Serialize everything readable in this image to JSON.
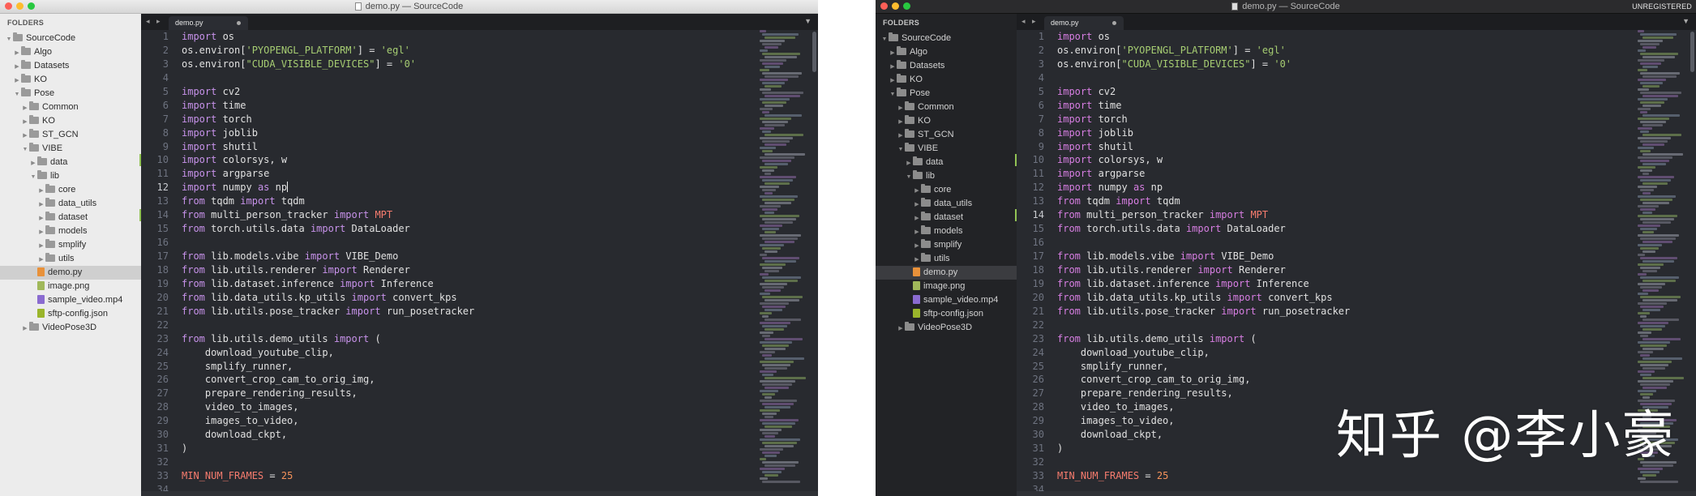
{
  "window_title": "demo.py — SourceCode",
  "unregistered_label": "UNREGISTERED",
  "sidebar": {
    "header": "FOLDERS",
    "items": [
      {
        "label": "SourceCode",
        "indent": 0,
        "type": "folder",
        "open": true
      },
      {
        "label": "Algo",
        "indent": 1,
        "type": "folder",
        "open": false
      },
      {
        "label": "Datasets",
        "indent": 1,
        "type": "folder",
        "open": false
      },
      {
        "label": "KO",
        "indent": 1,
        "type": "folder",
        "open": false
      },
      {
        "label": "Pose",
        "indent": 1,
        "type": "folder",
        "open": true
      },
      {
        "label": "Common",
        "indent": 2,
        "type": "folder",
        "open": false
      },
      {
        "label": "KO",
        "indent": 2,
        "type": "folder",
        "open": false
      },
      {
        "label": "ST_GCN",
        "indent": 2,
        "type": "folder",
        "open": false
      },
      {
        "label": "VIBE",
        "indent": 2,
        "type": "folder",
        "open": true
      },
      {
        "label": "data",
        "indent": 3,
        "type": "folder",
        "open": false
      },
      {
        "label": "lib",
        "indent": 3,
        "type": "folder",
        "open": true
      },
      {
        "label": "core",
        "indent": 4,
        "type": "folder",
        "open": false
      },
      {
        "label": "data_utils",
        "indent": 4,
        "type": "folder",
        "open": false
      },
      {
        "label": "dataset",
        "indent": 4,
        "type": "folder",
        "open": false
      },
      {
        "label": "models",
        "indent": 4,
        "type": "folder",
        "open": false
      },
      {
        "label": "smplify",
        "indent": 4,
        "type": "folder",
        "open": false
      },
      {
        "label": "utils",
        "indent": 4,
        "type": "folder",
        "open": false
      },
      {
        "label": "demo.py",
        "indent": 3,
        "type": "py",
        "selected": true
      },
      {
        "label": "image.png",
        "indent": 3,
        "type": "png"
      },
      {
        "label": "sample_video.mp4",
        "indent": 3,
        "type": "mp4"
      },
      {
        "label": "sftp-config.json",
        "indent": 3,
        "type": "json"
      },
      {
        "label": "VideoPose3D",
        "indent": 2,
        "type": "folder",
        "open": false
      }
    ]
  },
  "tab": {
    "label": "demo.py",
    "nav_glyphs": "◂ ▸",
    "dropdown_glyph": "▼"
  },
  "editor": {
    "active_line_light": 12,
    "active_line_dark": 14,
    "modified_lines": [
      10,
      14
    ],
    "lines": [
      [
        [
          "kw",
          "import"
        ],
        [
          "p",
          " os"
        ]
      ],
      [
        [
          "p",
          "os.environ["
        ],
        [
          "str",
          "'PYOPENGL_PLATFORM'"
        ],
        [
          "p",
          "] = "
        ],
        [
          "str",
          "'egl'"
        ]
      ],
      [
        [
          "p",
          "os.environ["
        ],
        [
          "str",
          "\"CUDA_VISIBLE_DEVICES\""
        ],
        [
          "p",
          "] = "
        ],
        [
          "str",
          "'0'"
        ]
      ],
      [],
      [
        [
          "kw",
          "import"
        ],
        [
          "p",
          " cv2"
        ]
      ],
      [
        [
          "kw",
          "import"
        ],
        [
          "p",
          " time"
        ]
      ],
      [
        [
          "kw",
          "import"
        ],
        [
          "p",
          " torch"
        ]
      ],
      [
        [
          "kw",
          "import"
        ],
        [
          "p",
          " joblib"
        ]
      ],
      [
        [
          "kw",
          "import"
        ],
        [
          "p",
          " shutil"
        ]
      ],
      [
        [
          "kw",
          "import"
        ],
        [
          "p",
          " colorsys, w"
        ]
      ],
      [
        [
          "kw",
          "import"
        ],
        [
          "p",
          " argparse"
        ]
      ],
      [
        [
          "kw",
          "import"
        ],
        [
          "p",
          " numpy "
        ],
        [
          "kw",
          "as"
        ],
        [
          "p",
          " np"
        ]
      ],
      [
        [
          "kw",
          "from"
        ],
        [
          "p",
          " tqdm "
        ],
        [
          "kw",
          "import"
        ],
        [
          "p",
          " tqdm"
        ]
      ],
      [
        [
          "kw",
          "from"
        ],
        [
          "p",
          " multi_person_tracker "
        ],
        [
          "kw",
          "import"
        ],
        [
          "p",
          " "
        ],
        [
          "cls",
          "MPT"
        ]
      ],
      [
        [
          "kw",
          "from"
        ],
        [
          "p",
          " torch.utils.data "
        ],
        [
          "kw",
          "import"
        ],
        [
          "p",
          " DataLoader"
        ]
      ],
      [],
      [
        [
          "kw",
          "from"
        ],
        [
          "p",
          " lib.models.vibe "
        ],
        [
          "kw",
          "import"
        ],
        [
          "p",
          " VIBE_Demo"
        ]
      ],
      [
        [
          "kw",
          "from"
        ],
        [
          "p",
          " lib.utils.renderer "
        ],
        [
          "kw",
          "import"
        ],
        [
          "p",
          " Renderer"
        ]
      ],
      [
        [
          "kw",
          "from"
        ],
        [
          "p",
          " lib.dataset.inference "
        ],
        [
          "kw",
          "import"
        ],
        [
          "p",
          " Inference"
        ]
      ],
      [
        [
          "kw",
          "from"
        ],
        [
          "p",
          " lib.data_utils.kp_utils "
        ],
        [
          "kw",
          "import"
        ],
        [
          "p",
          " convert_kps"
        ]
      ],
      [
        [
          "kw",
          "from"
        ],
        [
          "p",
          " lib.utils.pose_tracker "
        ],
        [
          "kw",
          "import"
        ],
        [
          "p",
          " run_posetracker"
        ]
      ],
      [],
      [
        [
          "kw",
          "from"
        ],
        [
          "p",
          " lib.utils.demo_utils "
        ],
        [
          "kw",
          "import"
        ],
        [
          "p",
          " ("
        ]
      ],
      [
        [
          "p",
          "    download_youtube_clip,"
        ]
      ],
      [
        [
          "p",
          "    smplify_runner,"
        ]
      ],
      [
        [
          "p",
          "    convert_crop_cam_to_orig_img,"
        ]
      ],
      [
        [
          "p",
          "    prepare_rendering_results,"
        ]
      ],
      [
        [
          "p",
          "    video_to_images,"
        ]
      ],
      [
        [
          "p",
          "    images_to_video,"
        ]
      ],
      [
        [
          "p",
          "    download_ckpt,"
        ]
      ],
      [
        [
          "p",
          ")"
        ]
      ],
      [],
      [
        [
          "cls",
          "MIN_NUM_FRAMES"
        ],
        [
          "p",
          " = "
        ],
        [
          "num",
          "25"
        ]
      ],
      []
    ]
  },
  "watermark": "知乎 @李小豪",
  "colors": {
    "editor_bg": "#282a2f",
    "keyword": "#c792ea",
    "string": "#a6cd72",
    "number": "#f6935b",
    "constant": "#f77c6e",
    "modified_marker": "#92c354"
  }
}
